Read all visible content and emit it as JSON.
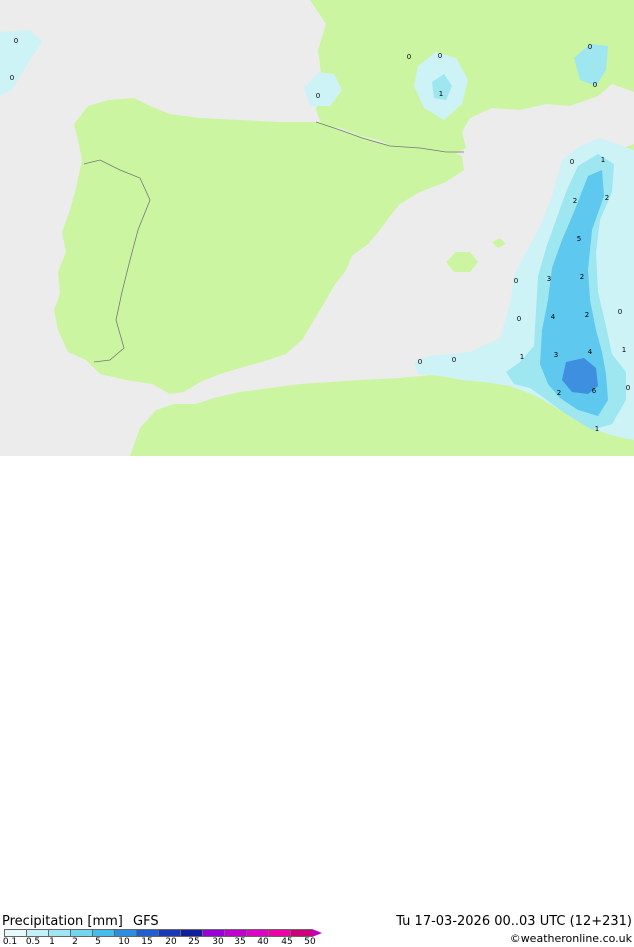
{
  "title": {
    "label": "Precipitation [mm]",
    "model": "GFS"
  },
  "datetime": "Tu 17-03-2026 00..03 UTC (12+231)",
  "credit": "©weatheronline.co.uk",
  "colors": {
    "sea": "#ececec",
    "land": "#ccf5a2",
    "light_precip": "#cdf3f6",
    "mid_precip": "#9ee6f0",
    "heavy_precip": "#5fc8ee",
    "core_precip": "#3f8fe0"
  },
  "colorbar": {
    "labels": [
      "0.1",
      "0.5",
      "1",
      "2",
      "5",
      "10",
      "15",
      "20",
      "25",
      "30",
      "35",
      "40",
      "45",
      "50"
    ],
    "colors": [
      "#e6fafd",
      "#c2f1f8",
      "#9ee6f3",
      "#72d6ee",
      "#45bdea",
      "#2a8fe0",
      "#1f5fd0",
      "#1838b8",
      "#10209a",
      "#9a00d8",
      "#c000d0",
      "#e000c8",
      "#f000a8",
      "#d0007a"
    ]
  },
  "map_values": [
    {
      "text": "0"
    },
    {
      "text": "0"
    },
    {
      "text": "0"
    },
    {
      "text": "0"
    },
    {
      "text": "0"
    },
    {
      "text": "1"
    },
    {
      "text": "0"
    },
    {
      "text": "0"
    },
    {
      "text": "0"
    },
    {
      "text": "1"
    },
    {
      "text": "2"
    },
    {
      "text": "2"
    },
    {
      "text": "5"
    },
    {
      "text": "0"
    },
    {
      "text": "3"
    },
    {
      "text": "2"
    },
    {
      "text": "0"
    },
    {
      "text": "4"
    },
    {
      "text": "2"
    },
    {
      "text": "0"
    },
    {
      "text": "0"
    },
    {
      "text": "0"
    },
    {
      "text": "1"
    },
    {
      "text": "3"
    },
    {
      "text": "4"
    },
    {
      "text": "1"
    },
    {
      "text": "2"
    },
    {
      "text": "6"
    },
    {
      "text": "0"
    },
    {
      "text": "1"
    }
  ]
}
